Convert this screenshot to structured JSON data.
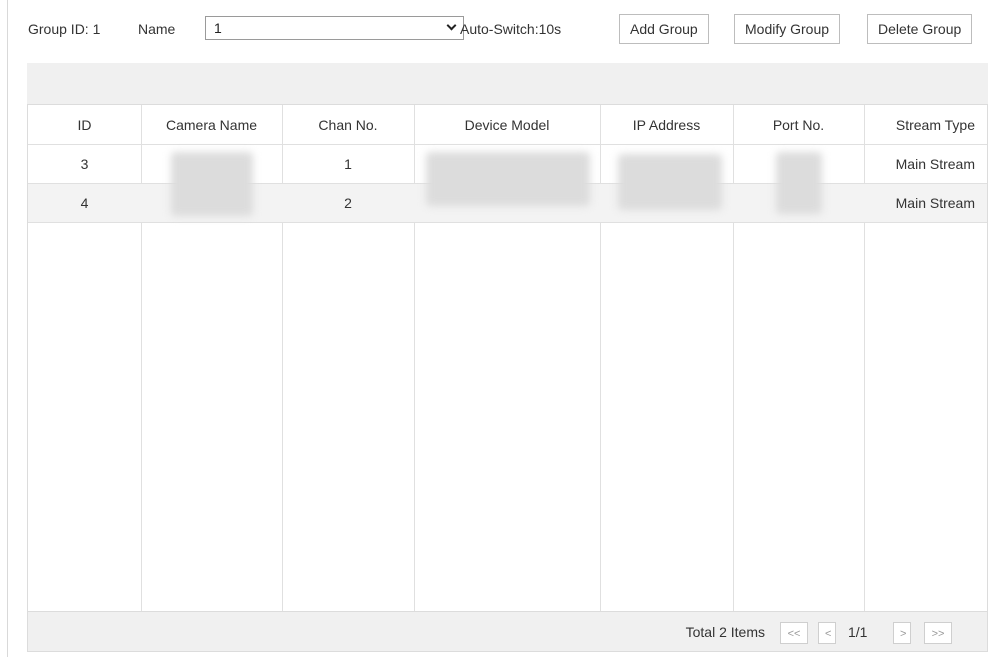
{
  "toolbar": {
    "group_id_label": "Group ID: 1",
    "name_label": "Name",
    "name_selected": "1",
    "auto_switch": "Auto-Switch:10s",
    "add_group": "Add Group",
    "modify_group": "Modify Group",
    "delete_group": "Delete Group"
  },
  "table": {
    "headers": [
      "ID",
      "Camera Name",
      "Chan No.",
      "Device Model",
      "IP Address",
      "Port No.",
      "Stream Type"
    ],
    "rows": [
      {
        "id": "3",
        "camera_name": "",
        "chan_no": "1",
        "device_model": "",
        "ip_address": "",
        "port_no": "",
        "stream_type": "Main Stream"
      },
      {
        "id": "4",
        "camera_name": "",
        "chan_no": "2",
        "device_model": "",
        "ip_address": "",
        "port_no": "",
        "stream_type": "Main Stream"
      }
    ]
  },
  "pagination": {
    "total": "Total 2 Items",
    "first": "<<",
    "prev": "<",
    "page": "1/1",
    "next": ">",
    "last": ">>"
  }
}
